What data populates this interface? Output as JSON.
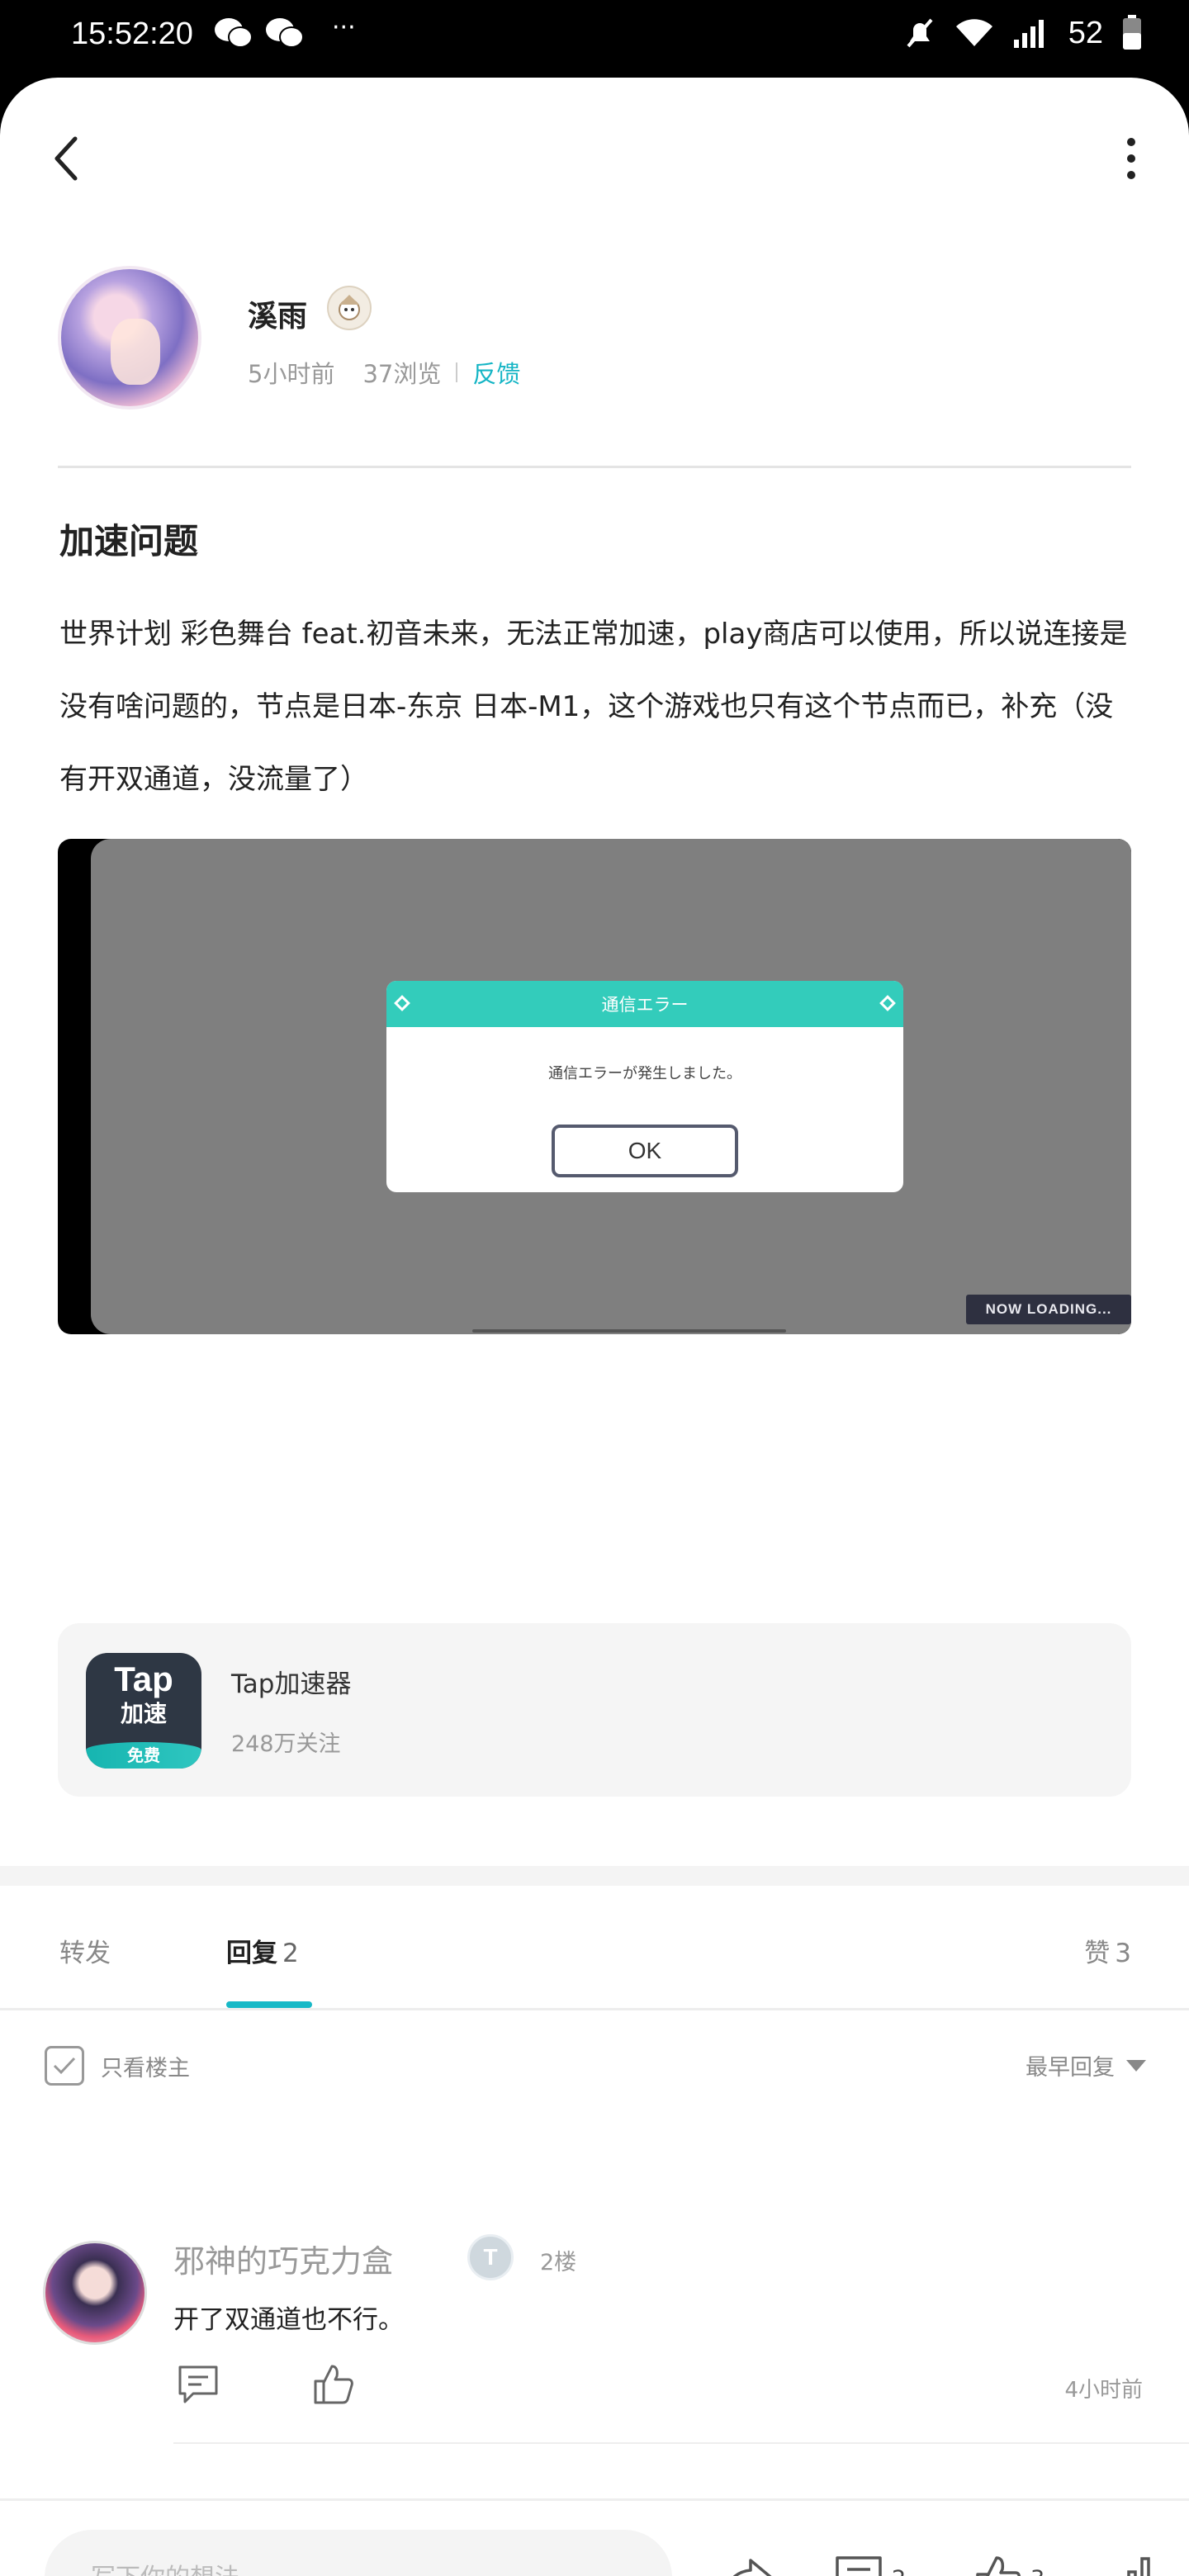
{
  "status_bar": {
    "time": "15:52:20",
    "dots": "···",
    "battery": "52"
  },
  "author": {
    "name": "溪雨",
    "time_ago": "5小时前",
    "views": "37浏览",
    "feedback": "反馈"
  },
  "post": {
    "title": "加速问题",
    "body": "世界计划 彩色舞台 feat.初音未来，无法正常加速，play商店可以使用，所以说连接是没有啥问题的，节点是日本-东京 日本-M1，这个游戏也只有这个节点而已，补充（没有开双通道，没流量了）",
    "image": {
      "dialog_title": "通信エラー",
      "dialog_message": "通信エラーが発生しました。",
      "ok_label": "OK",
      "loading_label": "NOW LOADING..."
    }
  },
  "app_card": {
    "icon_line1": "Tap",
    "icon_line2": "加速",
    "icon_badge": "免费",
    "name": "Tap加速器",
    "followers": "248万关注"
  },
  "tabs": {
    "repost": "转发",
    "reply": "回复",
    "reply_count": "2",
    "like": "赞",
    "like_count": "3"
  },
  "filters": {
    "only_op": "只看楼主",
    "sort": "最早回复"
  },
  "comments": [
    {
      "name": "邪神的巧克力盒",
      "level_badge": "T",
      "floor": "2楼",
      "text": "开了双通道也不行。",
      "time": "4小时前"
    }
  ],
  "bottom_bar": {
    "placeholder": "写下你的想法...",
    "comment_count": "2",
    "like_count": "3"
  },
  "colors": {
    "accent": "#18b9c7",
    "dialog_header": "#33ccbb"
  }
}
